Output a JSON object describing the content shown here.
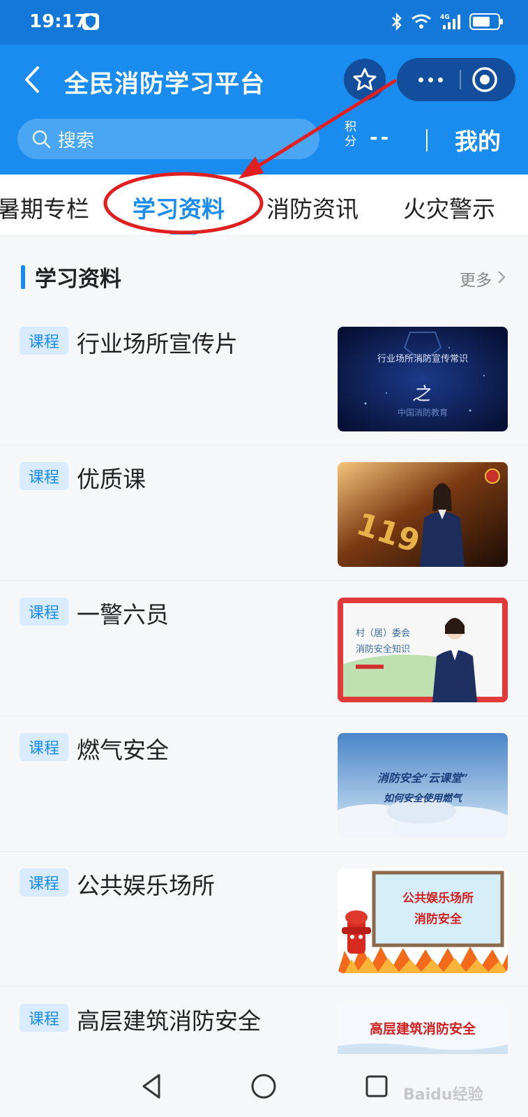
{
  "status_bar": {
    "time": "19:17",
    "network": "4G"
  },
  "header": {
    "title": "全民消防学习平台",
    "search_placeholder": "搜索",
    "points_label": "积分",
    "points_value": "--",
    "my_label": "我的"
  },
  "tabs": [
    {
      "label": "暑期专栏",
      "active": false
    },
    {
      "label": "学习资料",
      "active": true
    },
    {
      "label": "消防资讯",
      "active": false
    },
    {
      "label": "火灾警示",
      "active": false
    }
  ],
  "section": {
    "title": "学习资料",
    "more": "更多"
  },
  "items": [
    {
      "badge": "课程",
      "title": "行业场所宣传片",
      "thumb_text": "行业场所消防宣传常识",
      "thumb_sub": "中国消防教育"
    },
    {
      "badge": "课程",
      "title": "优质课",
      "thumb_text": "119"
    },
    {
      "badge": "课程",
      "title": "一警六员",
      "thumb_text": "村（居）委会",
      "thumb_sub": "消防安全知识"
    },
    {
      "badge": "课程",
      "title": "燃气安全",
      "thumb_text": "消防安全“云课堂”",
      "thumb_sub": "如何安全使用燃气"
    },
    {
      "badge": "课程",
      "title": "公共娱乐场所",
      "thumb_text": "公共娱乐场所",
      "thumb_sub": "消防安全"
    },
    {
      "badge": "课程",
      "title": "高层建筑消防安全",
      "thumb_text": "高层建筑消防安全"
    }
  ],
  "watermark": "Baidu经验",
  "colors": {
    "primary": "#1a8cf0",
    "status_bar": "#1478d8",
    "annotation": "#e02020"
  }
}
